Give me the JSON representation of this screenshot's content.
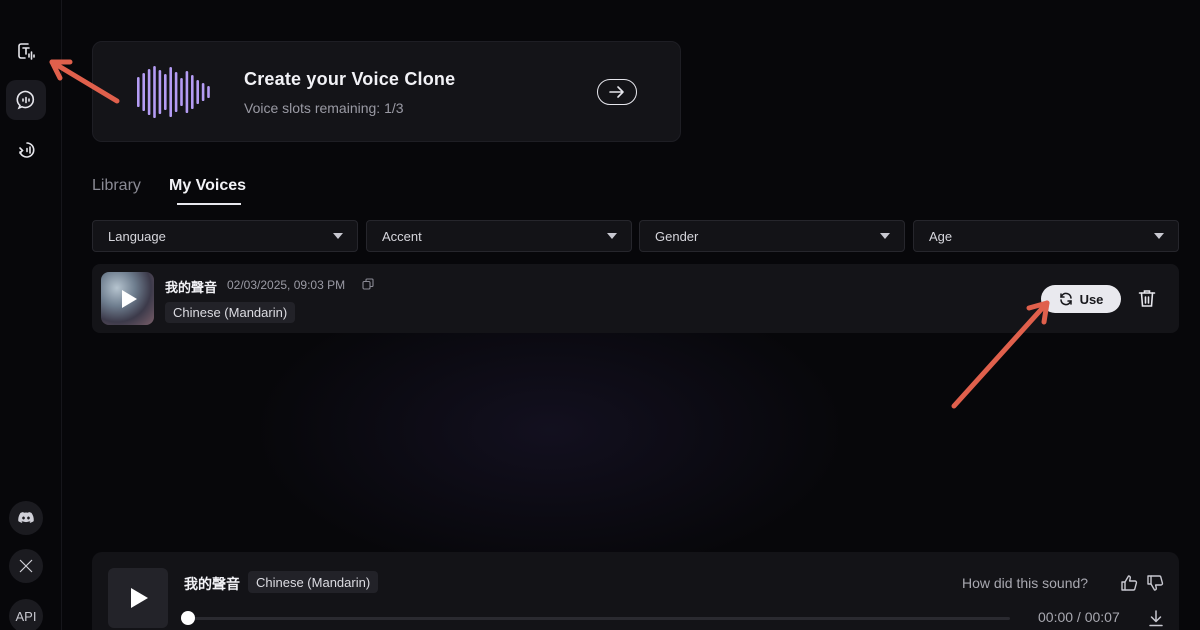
{
  "sidebar": {
    "items": [
      {
        "icon": "text-to-speech-icon",
        "active": false
      },
      {
        "icon": "chat-voice-icon",
        "active": true
      },
      {
        "icon": "voice-changer-icon",
        "active": false
      }
    ],
    "social": [
      {
        "icon": "discord-icon",
        "label": ""
      },
      {
        "icon": "x-icon",
        "label": ""
      },
      {
        "icon": "api-icon",
        "label": "API"
      }
    ]
  },
  "hero": {
    "title": "Create your Voice Clone",
    "subtitle": "Voice slots remaining: 1/3",
    "wave_color": "#b49cf4"
  },
  "tabs": [
    {
      "label": "Library",
      "active": false
    },
    {
      "label": "My Voices",
      "active": true
    }
  ],
  "filters": [
    {
      "label": "Language"
    },
    {
      "label": "Accent"
    },
    {
      "label": "Gender"
    },
    {
      "label": "Age"
    }
  ],
  "voices": [
    {
      "name": "我的聲音",
      "date": "02/03/2025, 09:03 PM",
      "language": "Chinese (Mandarin)",
      "use_label": "Use"
    }
  ],
  "player": {
    "name": "我的聲音",
    "language": "Chinese (Mandarin)",
    "feedback_question": "How did this sound?",
    "time": "00:00 / 00:07",
    "progress": 0
  },
  "annotation_color": "#e0604c"
}
